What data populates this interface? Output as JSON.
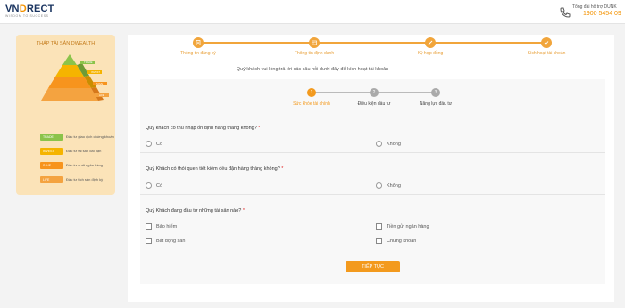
{
  "header": {
    "logo_main_a": "VN",
    "logo_main_b": "D",
    "logo_main_c": "RECT",
    "logo_sub": "WISDOM TO SUCCESS",
    "hotline_label": "Tổng đài hỗ trợ DUNK",
    "hotline_number": "1900 5454 09",
    "icons": {
      "phone": "phone-icon"
    }
  },
  "sidebar": {
    "title": "THÁP TÀI SẢN DWEALTH",
    "pyramid_labels": [
      "TRADE",
      "INVEST",
      "SAVE",
      "LIFE"
    ],
    "legend": [
      {
        "tag": "TRADE",
        "text": "Đầu tư giao dịch chứng khoán",
        "color": "#8bc34a"
      },
      {
        "tag": "INVEST",
        "text": "Đầu tư tài sản dài hạn",
        "color": "#f5b400"
      },
      {
        "tag": "SAVE",
        "text": "Đầu tư suất ngân hàng",
        "color": "#f7941d"
      },
      {
        "tag": "LIFE",
        "text": "Đầu tư tích sản định kỳ",
        "color": "#f4a340"
      }
    ]
  },
  "steps": [
    {
      "label": "Thông tin đăng ký",
      "icon": "document-icon"
    },
    {
      "label": "Thông tin định danh",
      "icon": "id-card-icon"
    },
    {
      "label": "Ký hợp đồng",
      "icon": "pen-icon"
    },
    {
      "label": "Kích hoạt tài khoản",
      "icon": "check-icon"
    }
  ],
  "intro": "Quý khách vui lòng trả lời các câu hỏi dưới đây để kích hoạt tài khoản",
  "substeps": [
    {
      "num": "1",
      "label": "Sức khỏe tài chính"
    },
    {
      "num": "2",
      "label": "Điều kiện đầu tư"
    },
    {
      "num": "3",
      "label": "Năng lực đầu tư"
    }
  ],
  "questions": [
    {
      "text": "Quý khách có thu nhập ổn định hàng tháng không?",
      "req": "*",
      "options": [
        "Có",
        "Không"
      ]
    },
    {
      "text": "Quý Khách có thói quen tiết kiệm đều đặn hàng tháng không?",
      "req": "*",
      "options": [
        "Có",
        "Không"
      ]
    },
    {
      "text": "Quý Khách đang đầu tư những tài sản nào?",
      "req": "*",
      "options": [
        "Bảo hiểm",
        "Tiền gửi ngân hàng",
        "Bất động sản",
        "Chứng khoán"
      ]
    }
  ],
  "submit_label": "TIẾP TỤC",
  "colors": {
    "accent": "#f39a1e",
    "brand": "#1a3460",
    "inactive": "#aaaaaa"
  }
}
